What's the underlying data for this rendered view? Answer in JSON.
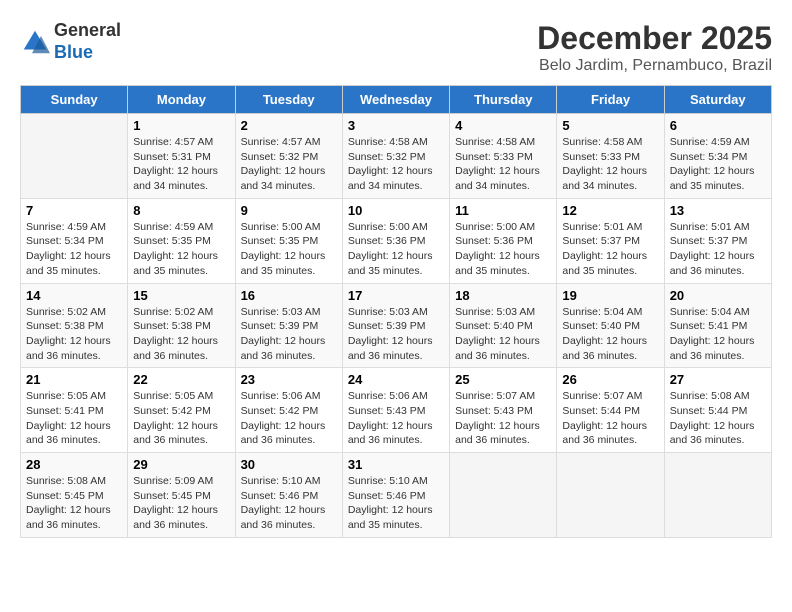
{
  "header": {
    "logo_line1": "General",
    "logo_line2": "Blue",
    "title": "December 2025",
    "subtitle": "Belo Jardim, Pernambuco, Brazil"
  },
  "weekdays": [
    "Sunday",
    "Monday",
    "Tuesday",
    "Wednesday",
    "Thursday",
    "Friday",
    "Saturday"
  ],
  "weeks": [
    [
      {
        "day": "",
        "info": ""
      },
      {
        "day": "1",
        "info": "Sunrise: 4:57 AM\nSunset: 5:31 PM\nDaylight: 12 hours\nand 34 minutes."
      },
      {
        "day": "2",
        "info": "Sunrise: 4:57 AM\nSunset: 5:32 PM\nDaylight: 12 hours\nand 34 minutes."
      },
      {
        "day": "3",
        "info": "Sunrise: 4:58 AM\nSunset: 5:32 PM\nDaylight: 12 hours\nand 34 minutes."
      },
      {
        "day": "4",
        "info": "Sunrise: 4:58 AM\nSunset: 5:33 PM\nDaylight: 12 hours\nand 34 minutes."
      },
      {
        "day": "5",
        "info": "Sunrise: 4:58 AM\nSunset: 5:33 PM\nDaylight: 12 hours\nand 34 minutes."
      },
      {
        "day": "6",
        "info": "Sunrise: 4:59 AM\nSunset: 5:34 PM\nDaylight: 12 hours\nand 35 minutes."
      }
    ],
    [
      {
        "day": "7",
        "info": "Sunrise: 4:59 AM\nSunset: 5:34 PM\nDaylight: 12 hours\nand 35 minutes."
      },
      {
        "day": "8",
        "info": "Sunrise: 4:59 AM\nSunset: 5:35 PM\nDaylight: 12 hours\nand 35 minutes."
      },
      {
        "day": "9",
        "info": "Sunrise: 5:00 AM\nSunset: 5:35 PM\nDaylight: 12 hours\nand 35 minutes."
      },
      {
        "day": "10",
        "info": "Sunrise: 5:00 AM\nSunset: 5:36 PM\nDaylight: 12 hours\nand 35 minutes."
      },
      {
        "day": "11",
        "info": "Sunrise: 5:00 AM\nSunset: 5:36 PM\nDaylight: 12 hours\nand 35 minutes."
      },
      {
        "day": "12",
        "info": "Sunrise: 5:01 AM\nSunset: 5:37 PM\nDaylight: 12 hours\nand 35 minutes."
      },
      {
        "day": "13",
        "info": "Sunrise: 5:01 AM\nSunset: 5:37 PM\nDaylight: 12 hours\nand 36 minutes."
      }
    ],
    [
      {
        "day": "14",
        "info": "Sunrise: 5:02 AM\nSunset: 5:38 PM\nDaylight: 12 hours\nand 36 minutes."
      },
      {
        "day": "15",
        "info": "Sunrise: 5:02 AM\nSunset: 5:38 PM\nDaylight: 12 hours\nand 36 minutes."
      },
      {
        "day": "16",
        "info": "Sunrise: 5:03 AM\nSunset: 5:39 PM\nDaylight: 12 hours\nand 36 minutes."
      },
      {
        "day": "17",
        "info": "Sunrise: 5:03 AM\nSunset: 5:39 PM\nDaylight: 12 hours\nand 36 minutes."
      },
      {
        "day": "18",
        "info": "Sunrise: 5:03 AM\nSunset: 5:40 PM\nDaylight: 12 hours\nand 36 minutes."
      },
      {
        "day": "19",
        "info": "Sunrise: 5:04 AM\nSunset: 5:40 PM\nDaylight: 12 hours\nand 36 minutes."
      },
      {
        "day": "20",
        "info": "Sunrise: 5:04 AM\nSunset: 5:41 PM\nDaylight: 12 hours\nand 36 minutes."
      }
    ],
    [
      {
        "day": "21",
        "info": "Sunrise: 5:05 AM\nSunset: 5:41 PM\nDaylight: 12 hours\nand 36 minutes."
      },
      {
        "day": "22",
        "info": "Sunrise: 5:05 AM\nSunset: 5:42 PM\nDaylight: 12 hours\nand 36 minutes."
      },
      {
        "day": "23",
        "info": "Sunrise: 5:06 AM\nSunset: 5:42 PM\nDaylight: 12 hours\nand 36 minutes."
      },
      {
        "day": "24",
        "info": "Sunrise: 5:06 AM\nSunset: 5:43 PM\nDaylight: 12 hours\nand 36 minutes."
      },
      {
        "day": "25",
        "info": "Sunrise: 5:07 AM\nSunset: 5:43 PM\nDaylight: 12 hours\nand 36 minutes."
      },
      {
        "day": "26",
        "info": "Sunrise: 5:07 AM\nSunset: 5:44 PM\nDaylight: 12 hours\nand 36 minutes."
      },
      {
        "day": "27",
        "info": "Sunrise: 5:08 AM\nSunset: 5:44 PM\nDaylight: 12 hours\nand 36 minutes."
      }
    ],
    [
      {
        "day": "28",
        "info": "Sunrise: 5:08 AM\nSunset: 5:45 PM\nDaylight: 12 hours\nand 36 minutes."
      },
      {
        "day": "29",
        "info": "Sunrise: 5:09 AM\nSunset: 5:45 PM\nDaylight: 12 hours\nand 36 minutes."
      },
      {
        "day": "30",
        "info": "Sunrise: 5:10 AM\nSunset: 5:46 PM\nDaylight: 12 hours\nand 36 minutes."
      },
      {
        "day": "31",
        "info": "Sunrise: 5:10 AM\nSunset: 5:46 PM\nDaylight: 12 hours\nand 35 minutes."
      },
      {
        "day": "",
        "info": ""
      },
      {
        "day": "",
        "info": ""
      },
      {
        "day": "",
        "info": ""
      }
    ]
  ]
}
